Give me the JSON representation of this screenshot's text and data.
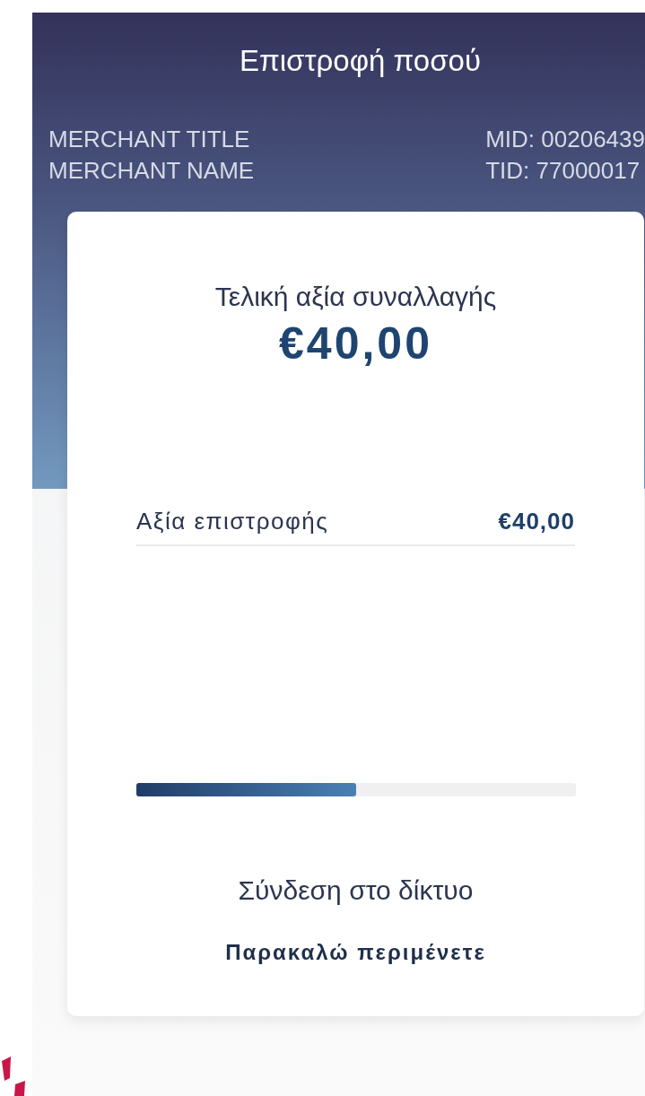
{
  "header": {
    "title": "Επιστροφή ποσού",
    "merchant_title": "MERCHANT TITLE",
    "merchant_name": "MERCHANT NAME",
    "mid": "MID: 00206439",
    "tid": "TID: 77000017"
  },
  "card": {
    "total_label": "Τελική αξία συναλλαγής",
    "total_amount": "€40,00",
    "rows": [
      {
        "label": "Αξία επιστροφής",
        "value": "€40,00"
      }
    ],
    "progress": {
      "level": 0.5
    },
    "status": "Σύνδεση στο δίκτυο",
    "message": "Παρακαλώ περιμένετε"
  }
}
